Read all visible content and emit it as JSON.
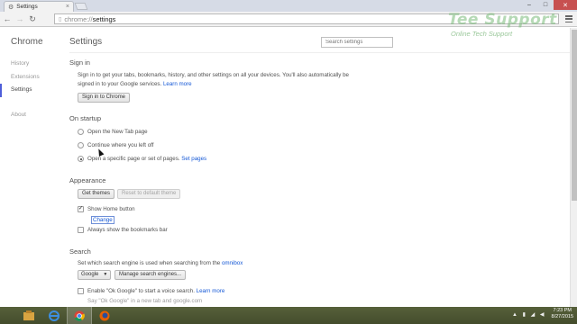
{
  "browser": {
    "tab_title": "Settings",
    "tab_close": "×",
    "window_controls": {
      "minimize": "–",
      "maximize": "□",
      "close": "✕"
    },
    "address": {
      "scheme": "chrome://",
      "path": "settings"
    }
  },
  "sidebar": {
    "title": "Chrome",
    "items": [
      {
        "label": "History"
      },
      {
        "label": "Extensions"
      },
      {
        "label": "Settings"
      },
      {
        "label": "About"
      }
    ]
  },
  "main": {
    "title": "Settings",
    "search_placeholder": "Search settings",
    "sign_in": {
      "heading": "Sign in",
      "description_line1": "Sign in to get your tabs, bookmarks, history, and other settings on all your devices. You'll also automatically be",
      "description_line2": "signed in to your Google services.",
      "learn_more": "Learn more",
      "button": "Sign in to Chrome"
    },
    "startup": {
      "heading": "On startup",
      "options": [
        {
          "label": "Open the New Tab page"
        },
        {
          "label": "Continue where you left off"
        },
        {
          "label": "Open a specific page or set of pages.",
          "link": "Set pages"
        }
      ]
    },
    "appearance": {
      "heading": "Appearance",
      "get_themes": "Get themes",
      "reset_theme": "Reset to default theme",
      "show_home": "Show Home button",
      "change": "Change",
      "show_bookmarks": "Always show the bookmarks bar",
      "checkmark": "✓"
    },
    "search": {
      "heading": "Search",
      "description": "Set which search engine is used when searching from the",
      "omnibox_link": "omnibox",
      "engine": "Google",
      "manage": "Manage search engines...",
      "ok_google": "Enable \"Ok Google\" to start a voice search.",
      "ok_google_learn": "Learn more",
      "hint": "Say \"Ok Google\" in a new tab and google.com"
    }
  },
  "watermark": {
    "brand": "Tee Support",
    "tagline": "Online Tech Support"
  },
  "taskbar": {
    "time": "7:23 PM",
    "date": "8/27/2015"
  },
  "colors": {
    "accent": "#4e5ed9",
    "link": "#1558d6",
    "taskbar": "#4b5432"
  }
}
